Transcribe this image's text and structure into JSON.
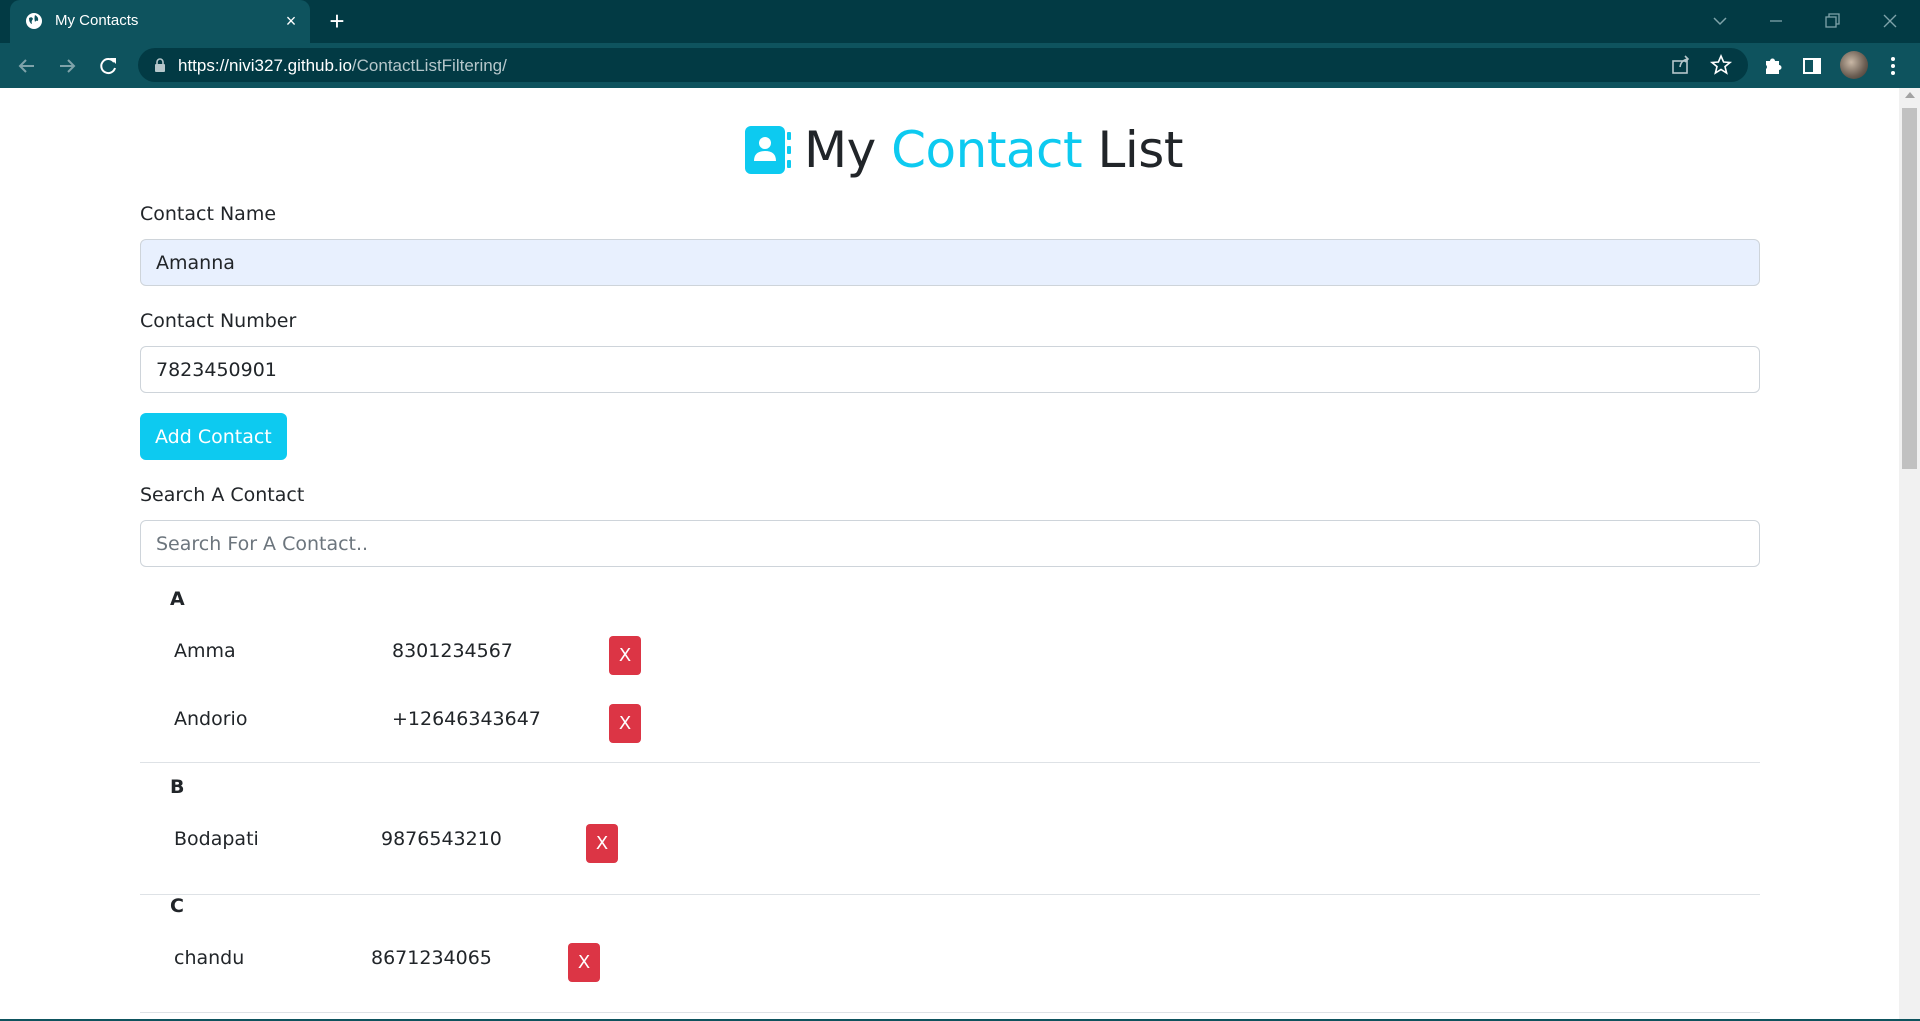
{
  "browser": {
    "tab_title": "My Contacts",
    "tab_close": "×",
    "new_tab": "+",
    "url_host": "https://nivi327.github.io",
    "url_path": "/ContactListFiltering/"
  },
  "page": {
    "heading_part1": "My ",
    "heading_accent": "Contact",
    "heading_part2": " List",
    "accent_color": "#0dcaf0",
    "danger_color": "#dc3545"
  },
  "form": {
    "name_label": "Contact Name",
    "name_value": "Amanna",
    "number_label": "Contact Number",
    "number_value": "7823450901",
    "add_button": "Add Contact",
    "search_label": "Search A Contact",
    "search_placeholder": "Search For A Contact.."
  },
  "groups": [
    {
      "letter": "A",
      "contacts": [
        {
          "name": "Amma",
          "number": "8301234567",
          "delete": "X"
        },
        {
          "name": "Andorio",
          "number": "+12646343647",
          "delete": "X"
        }
      ]
    },
    {
      "letter": "B",
      "contacts": [
        {
          "name": "Bodapati",
          "number": "9876543210",
          "delete": "X"
        }
      ]
    },
    {
      "letter": "C",
      "contacts": [
        {
          "name": "chandu",
          "number": "8671234065",
          "delete": "X"
        }
      ]
    }
  ]
}
